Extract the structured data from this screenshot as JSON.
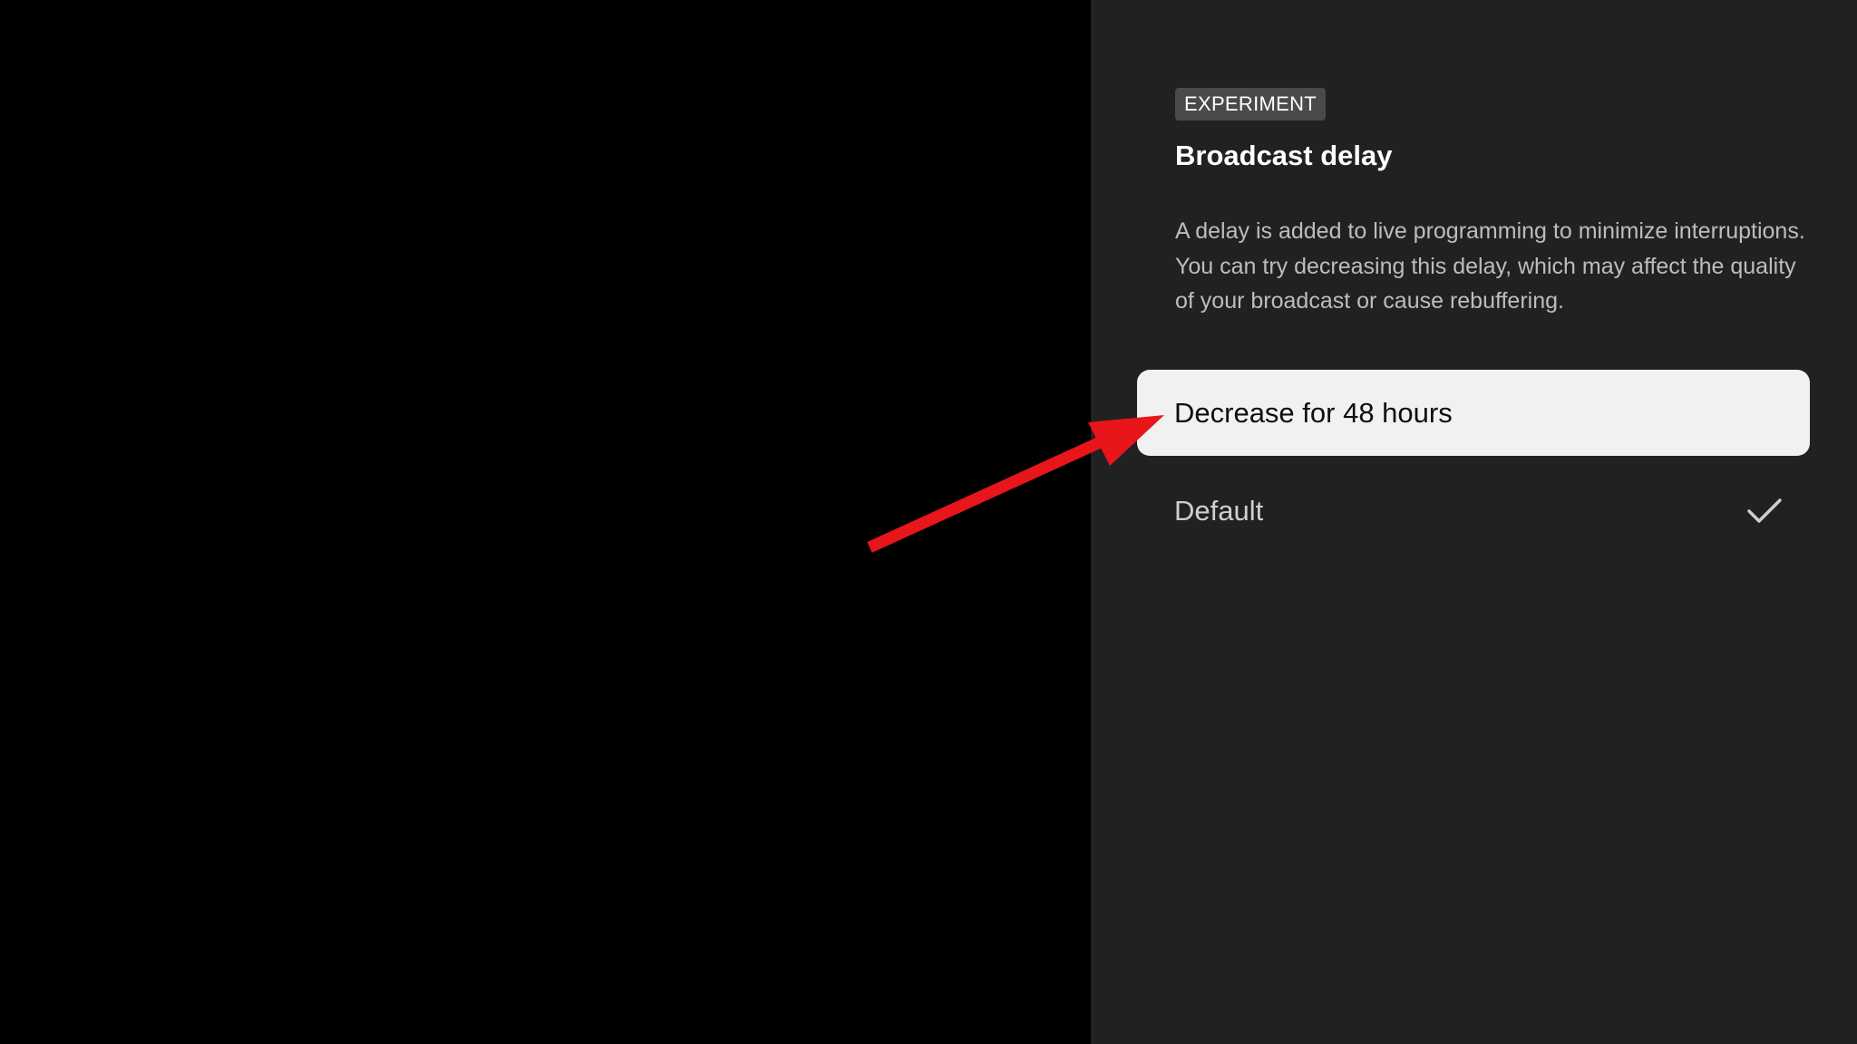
{
  "panel": {
    "badge": "EXPERIMENT",
    "title": "Broadcast delay",
    "description": "A delay is added to live programming to minimize interruptions. You can try decreasing this delay, which may affect the quality of your broadcast or cause rebuffering.",
    "options": [
      {
        "label": "Decrease for 48 hours",
        "focused": true,
        "selected": false
      },
      {
        "label": "Default",
        "focused": false,
        "selected": true
      }
    ]
  },
  "icons": {
    "selected_indicator": "check-icon",
    "annotation": "red-arrow-annotation"
  },
  "colors": {
    "panel_background": "#212121",
    "video_background": "#000000",
    "focused_option_background": "#f1f1f1",
    "annotation_arrow": "#e8151b"
  }
}
